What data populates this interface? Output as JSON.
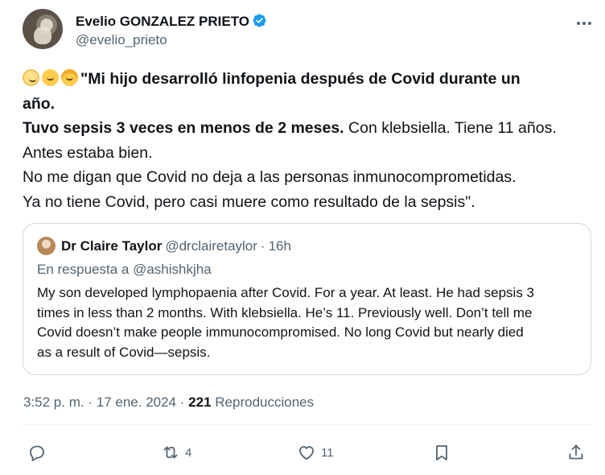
{
  "author": {
    "display_name": "Evelio GONZALEZ PRIETO",
    "handle": "@evelio_prieto",
    "verified": true
  },
  "tweet": {
    "emojis": [
      "baby-emoji",
      "child-emoji",
      "girl-emoji"
    ],
    "line1_bold": "\"Mi hijo desarrolló linfopenia después de Covid durante un",
    "line2_bold": "año.",
    "line3_bold": "Tuvo sepsis 3 veces en menos de 2 meses.",
    "line3_rest": " Con klebsiella. Tiene 11 años.",
    "line4": "Antes estaba bien.",
    "line5": "No me digan que Covid no deja a las personas inmunocomprometidas.",
    "line6": "Ya no tiene Covid, pero casi muere como resultado de la sepsis\"."
  },
  "quote": {
    "display_name": "Dr Claire Taylor",
    "handle": "@drclairetaylor",
    "separator": "·",
    "time": "16h",
    "reply_to": "En respuesta a @ashishkjha",
    "body_lines": [
      "My son developed lymphopaenia after Covid. For a year. At least. He had sepsis 3",
      "times in less than 2 months. With klebsiella. He’s 11. Previously well. Don’t tell me",
      "Covid doesn’t make people immunocompromised. No long Covid but nearly died",
      "as a result of Covid—sepsis."
    ]
  },
  "meta": {
    "time": "3:52 p. m.",
    "separator": "·",
    "date": "17 ene. 2024",
    "views_count": "221",
    "views_label": "Reproducciones"
  },
  "actions": {
    "reply_count": "",
    "retweet_count": "4",
    "like_count": "11"
  },
  "colors": {
    "verified": "#1d9bf0",
    "text": "#0f1419",
    "secondary": "#536471",
    "border": "#cfd9de"
  }
}
